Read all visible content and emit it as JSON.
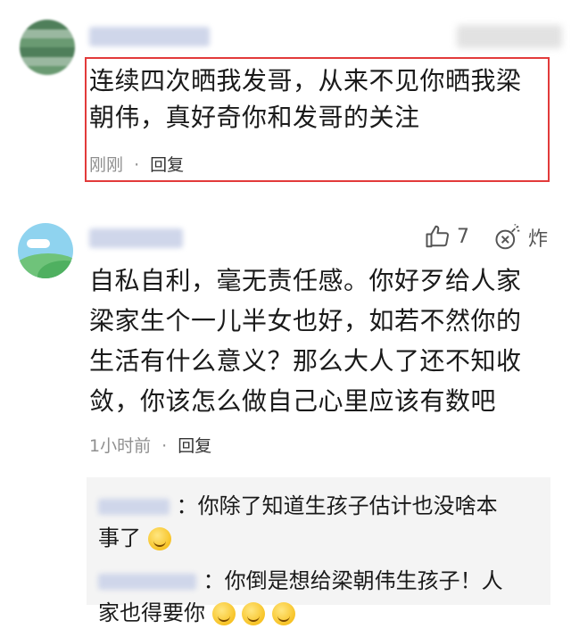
{
  "comment1": {
    "text_line1": "连续四次晒我发哥，从来不见你晒我梁",
    "text_line2": "朝伟，真好奇你和发哥的关注",
    "time": "刚刚",
    "dot": "·",
    "reply": "回复"
  },
  "comment2": {
    "like_count": "7",
    "bomb_label": "炸",
    "text_lines": [
      "自私自利，毫无责任感。你好歹给人家",
      "梁家生个一儿半女也好，如若不然你的",
      "生活有什么意义？那么大人了还不知收",
      "敛，你该怎么做自己心里应该有数吧"
    ],
    "time": "1小时前",
    "dot": "·",
    "reply": "回复"
  },
  "replies": [
    {
      "sep": "：",
      "line1": "你除了知道生孩子估计也没啥本",
      "line2": "事了"
    },
    {
      "sep": "：",
      "line1": "你倒是想给梁朝伟生孩子！人",
      "line2": "家也得要你"
    }
  ],
  "icons": {
    "like": "thumbs-up-icon",
    "bomb": "bomb-icon",
    "emoji": "grin-emoji-icon"
  },
  "colors": {
    "highlight_border": "#e23a3a",
    "meta_gray": "#8f8f8f",
    "reply_bg": "#f4f4f4"
  }
}
